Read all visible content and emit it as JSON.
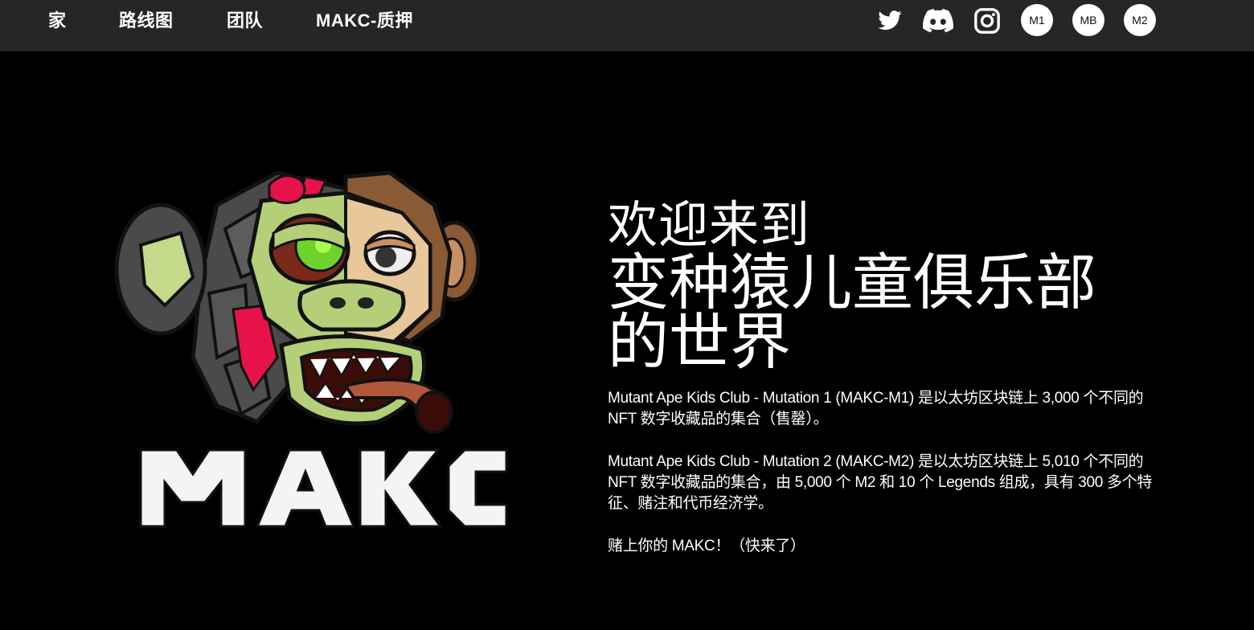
{
  "nav": {
    "home": "家",
    "roadmap": "路线图",
    "team": "团队",
    "staking": "MAKC-质押"
  },
  "social": {
    "twitter_icon": "twitter-icon",
    "discord_icon": "discord-icon",
    "instagram_icon": "instagram-icon"
  },
  "markets": {
    "m1": "M1",
    "mb": "MB",
    "m2": "M2"
  },
  "hero": {
    "logo_text": "MAKC",
    "welcome": "欢迎来到",
    "club_name": "变种猿儿童俱乐部",
    "world": "的世界",
    "para1": "Mutant Ape Kids Club - Mutation 1 (MAKC-M1) 是以太坊区块链上 3,000 个不同的 NFT 数字收藏品的集合（售罄）。",
    "para2": "Mutant Ape Kids Club - Mutation 2 (MAKC-M2) 是以太坊区块链上 5,010 个不同的 NFT 数字收藏品的集合，由 5,000 个 M2 和 10 个 Legends 组成，具有 300 多个特征、赌注和代币经济学。",
    "para3": "赌上你的 MAKC！（快来了）"
  },
  "colors": {
    "topbar": "#262626",
    "background": "#000000",
    "accent_red": "#e8124a",
    "ape_green": "#b5cf78"
  }
}
